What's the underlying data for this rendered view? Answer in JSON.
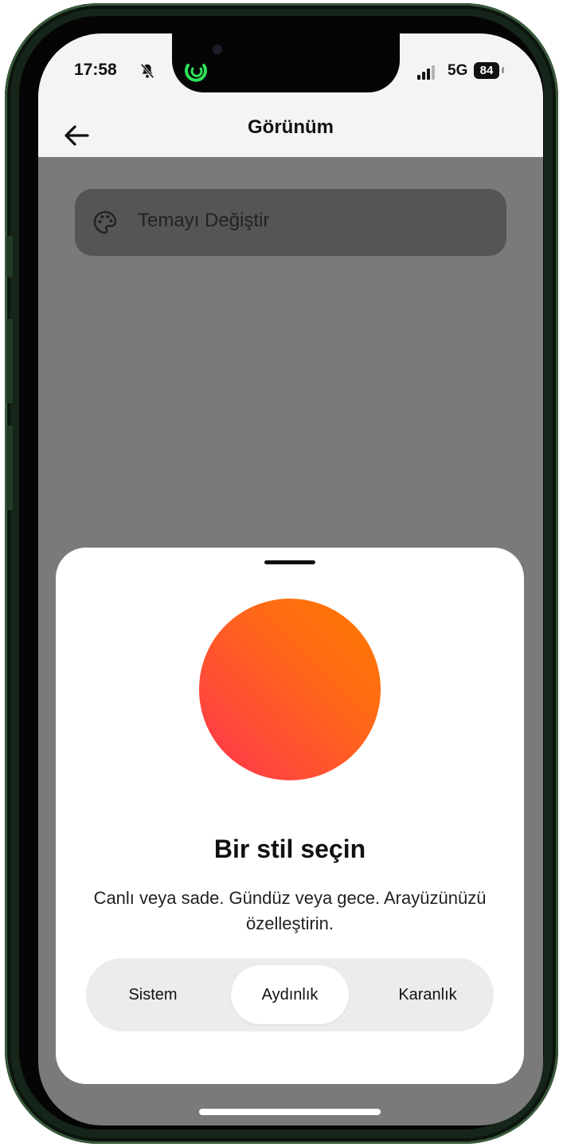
{
  "status_bar": {
    "time": "17:58",
    "network": "5G",
    "battery": "84",
    "icons": [
      "bell-slash-icon",
      "signal-bars-icon",
      "battery-icon",
      "call-ring-icon"
    ]
  },
  "header": {
    "title": "Görünüm",
    "back_icon": "arrow-left-icon"
  },
  "settings": {
    "theme_row": {
      "label": "Temayı Değiştir",
      "icon": "palette-icon"
    }
  },
  "sheet": {
    "title": "Bir stil seçin",
    "description": "Canlı veya sade. Gündüz veya gece. Arayüzünüzü özelleştirin.",
    "options": [
      "Sistem",
      "Aydınlık",
      "Karanlık"
    ],
    "selected": "Aydınlık",
    "orb_colors": [
      "#ff7a00",
      "#ff2d4e"
    ]
  },
  "colors": {
    "overlay": "#7a7a7a",
    "sheet": "#ffffff",
    "segment_track": "#ececec"
  }
}
